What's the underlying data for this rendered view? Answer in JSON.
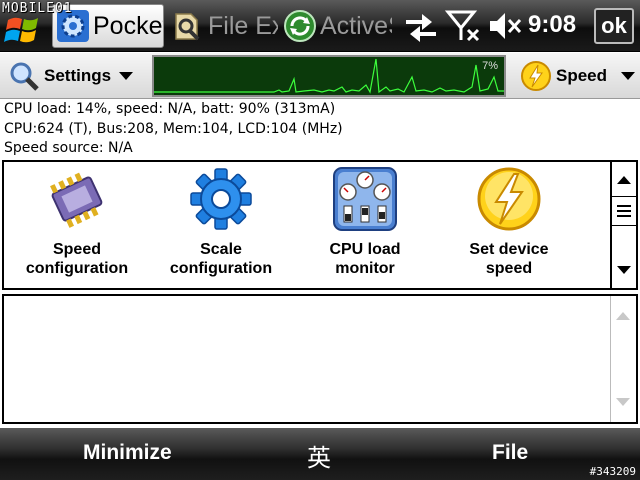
{
  "watermark": "MOBILE01",
  "taskbar": {
    "tabs": [
      {
        "label": "Pocket",
        "icon": "gear-app-icon",
        "active": true
      },
      {
        "label": "File Ex",
        "icon": "file-explorer-icon",
        "active": false
      },
      {
        "label": "ActiveS",
        "icon": "activesync-icon",
        "active": false
      }
    ],
    "status_icons": [
      "connectivity-icon",
      "no-signal-icon",
      "speaker-muted-icon"
    ],
    "time": "9:08",
    "ok_label": "ok"
  },
  "toolbar": {
    "settings_label": "Settings",
    "speed_label": "Speed",
    "graph_percent": "7%"
  },
  "info": {
    "line1": "CPU load: 14%, speed: N/A, batt: 90% (313mA)",
    "line2": "CPU:624 (T), Bus:208, Mem:104, LCD:104 (MHz)",
    "line3": "Speed source: N/A"
  },
  "panel": {
    "items": [
      {
        "line1": "Speed",
        "line2": "configuration",
        "icon": "chip-icon"
      },
      {
        "line1": "Scale",
        "line2": "configuration",
        "icon": "gear-icon"
      },
      {
        "line1": "CPU load",
        "line2": "monitor",
        "icon": "gauges-icon"
      },
      {
        "line1": "Set device",
        "line2": "speed",
        "icon": "lightning-icon"
      }
    ]
  },
  "softkeys": {
    "left": "Minimize",
    "ime": "英",
    "right": "File"
  },
  "post_id": "#343209",
  "colors": {
    "graph_bg": "#0b3a0b",
    "graph_line": "#3cff3c",
    "taskbar": "#1a1a1a",
    "toolbar": "#e6e6e6"
  }
}
